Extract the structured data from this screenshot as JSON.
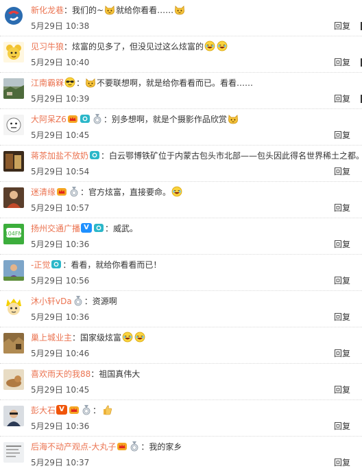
{
  "comments": [
    {
      "name": "新化龙巷",
      "text1": "我们的~",
      "text2": "就给你看看……",
      "time": "5月29日 10:38",
      "reply": "回复"
    },
    {
      "name": "见习牛狼",
      "text1": "炫富的见多了，但没见过这么炫富的",
      "time": "5月29日 10:40",
      "reply": "回复"
    },
    {
      "name": "江南霸槑",
      "text1": "不要联想啊，就是给你看看而已。看看……",
      "time": "5月29日 10:39",
      "reply": "回复"
    },
    {
      "name": "大阿呆Z6",
      "text1": "别多想啊，就是个摄影作品欣赏",
      "time": "5月29日 10:45",
      "reply": "回复"
    },
    {
      "name": "蒋茶加盐不放奶",
      "text1": "白云鄂博铁矿位于内蒙古包头市北部——包头因此得名世界稀土之都。",
      "time": "5月29日 10:54",
      "reply": "回复"
    },
    {
      "name": "迷清缘",
      "text1": "官方炫富，直接要命。",
      "time": "5月29日 10:57",
      "reply": "回复"
    },
    {
      "name": "扬州交通广播",
      "text1": "威武。",
      "time": "5月29日 10:36",
      "reply": "回复"
    },
    {
      "name": "-正觉",
      "text1": "看看，就给你看看而已！",
      "time": "5月29日 10:56",
      "reply": "回复"
    },
    {
      "name": "沐小轩vDa",
      "text1": "资源啊",
      "time": "5月29日 10:36",
      "reply": "回复"
    },
    {
      "name": "巢上城业主",
      "text1": "国家级炫富",
      "time": "5月29日 10:46",
      "reply": "回复"
    },
    {
      "name": "喜欢雨天的我88",
      "text1": "祖国真伟大",
      "time": "5月29日 10:45",
      "reply": "回复"
    },
    {
      "name": "彭大石",
      "text1": "",
      "time": "5月29日 10:36",
      "reply": "回复"
    },
    {
      "name": "后海不动产观点-大丸子",
      "text1": "我的家乡",
      "time": "5月29日 10:37",
      "reply": "回复"
    }
  ],
  "separator": "：",
  "badges": {
    "vip": "V",
    "vip_color": "#f0550a",
    "fans": "V",
    "fans_color": "#1e90ff"
  },
  "colors": {
    "name": "#eb7350",
    "text": "#333333",
    "divider": "#d9d9d9"
  },
  "avatar_text": {
    "yangzhou": "104FM"
  }
}
